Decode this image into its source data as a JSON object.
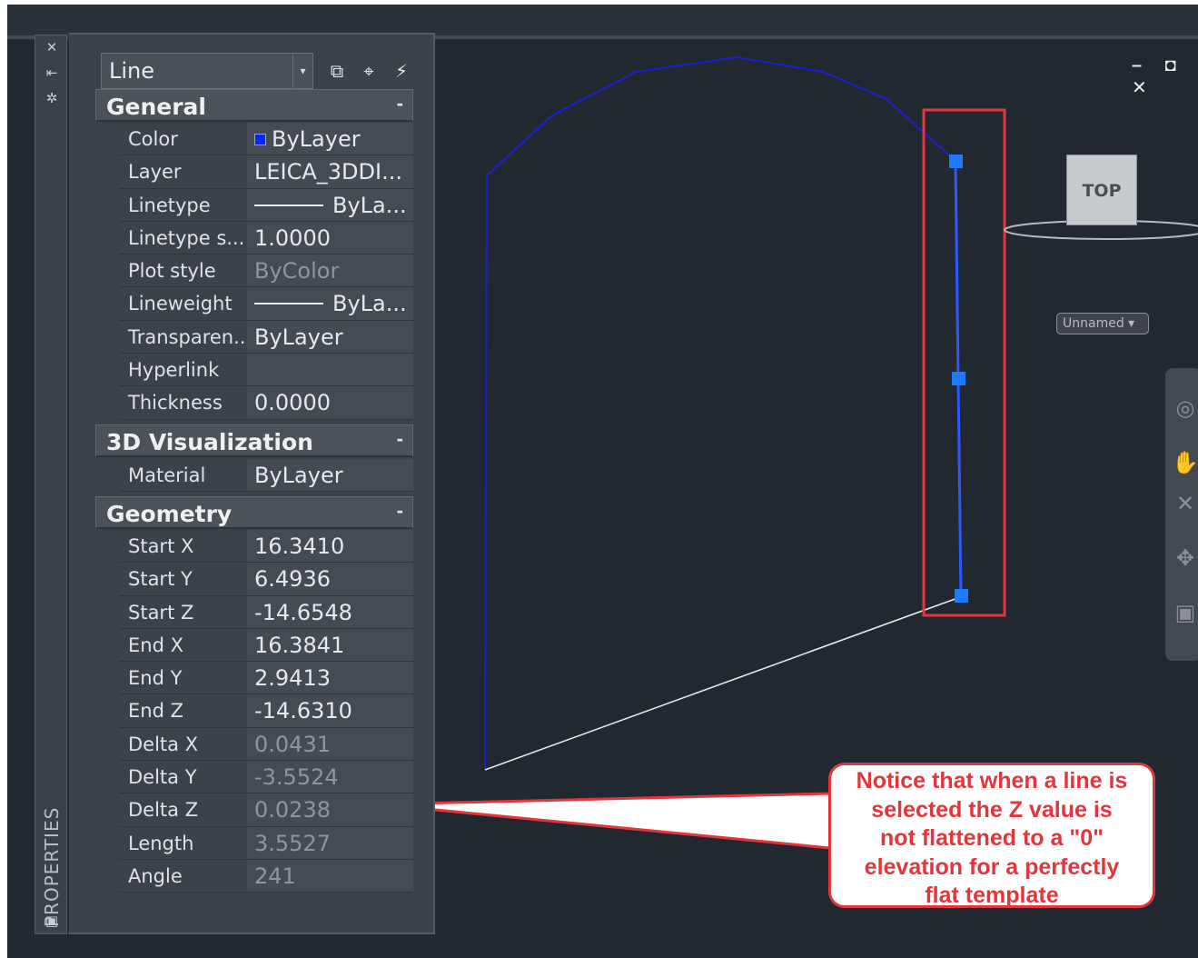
{
  "palette": {
    "strip_title": "PROPERTIES",
    "strip_icons": [
      "close-icon",
      "autohide-icon",
      "settings-icon",
      "properties-palette-icon"
    ],
    "object_type": "Line",
    "toolbar_icons": [
      "toggle-pickadd-icon",
      "select-objects-icon",
      "quick-select-icon"
    ]
  },
  "sections": {
    "general": {
      "title": "General",
      "collapse": "-",
      "rows": [
        {
          "label": "Color",
          "value": "ByLayer"
        },
        {
          "label": "Layer",
          "value": "LEICA_3DDI..."
        },
        {
          "label": "Linetype",
          "value": "ByLa..."
        },
        {
          "label": "Linetype s...",
          "value": "1.0000"
        },
        {
          "label": "Plot style",
          "value": "ByColor"
        },
        {
          "label": "Lineweight",
          "value": "ByLa..."
        },
        {
          "label": "Transparen...",
          "value": "ByLayer"
        },
        {
          "label": "Hyperlink",
          "value": ""
        },
        {
          "label": "Thickness",
          "value": "0.0000"
        }
      ]
    },
    "visualization": {
      "title": "3D Visualization",
      "collapse": "-",
      "rows": [
        {
          "label": "Material",
          "value": "ByLayer"
        }
      ]
    },
    "geometry": {
      "title": "Geometry",
      "collapse": "-",
      "rows": [
        {
          "label": "Start X",
          "value": "16.3410"
        },
        {
          "label": "Start Y",
          "value": "6.4936"
        },
        {
          "label": "Start Z",
          "value": "-14.6548"
        },
        {
          "label": "End X",
          "value": "16.3841"
        },
        {
          "label": "End Y",
          "value": "2.9413"
        },
        {
          "label": "End Z",
          "value": "-14.6310"
        },
        {
          "label": "Delta X",
          "value": "0.0431"
        },
        {
          "label": "Delta Y",
          "value": "-3.5524"
        },
        {
          "label": "Delta Z",
          "value": "0.0238"
        },
        {
          "label": "Length",
          "value": "3.5527"
        },
        {
          "label": "Angle",
          "value": "241"
        }
      ]
    }
  },
  "viewport": {
    "window_controls": "– ◘ ✕",
    "viewcube_face": "TOP",
    "ucs_label": "Unnamed",
    "nav_icons": [
      "steering-wheel-icon",
      "pan-icon",
      "zoom-icon",
      "orbit-icon",
      "showmotion-icon"
    ]
  },
  "callout": {
    "line1": "Notice that when a line is",
    "line2_a": "selected the ",
    "line2_b": "Z",
    "line2_c": " value is",
    "line3": "not flattened to a \"0\"",
    "line4": "elevation for a perfectly",
    "line5": "flat template"
  },
  "colors": {
    "drawing_bg": "#212830",
    "polyline": "#1a1fd0",
    "selected_line": "#2f57ff",
    "grip": "#1e7bff",
    "white_line": "#e8e8e8",
    "highlight_red": "#e3363c"
  }
}
